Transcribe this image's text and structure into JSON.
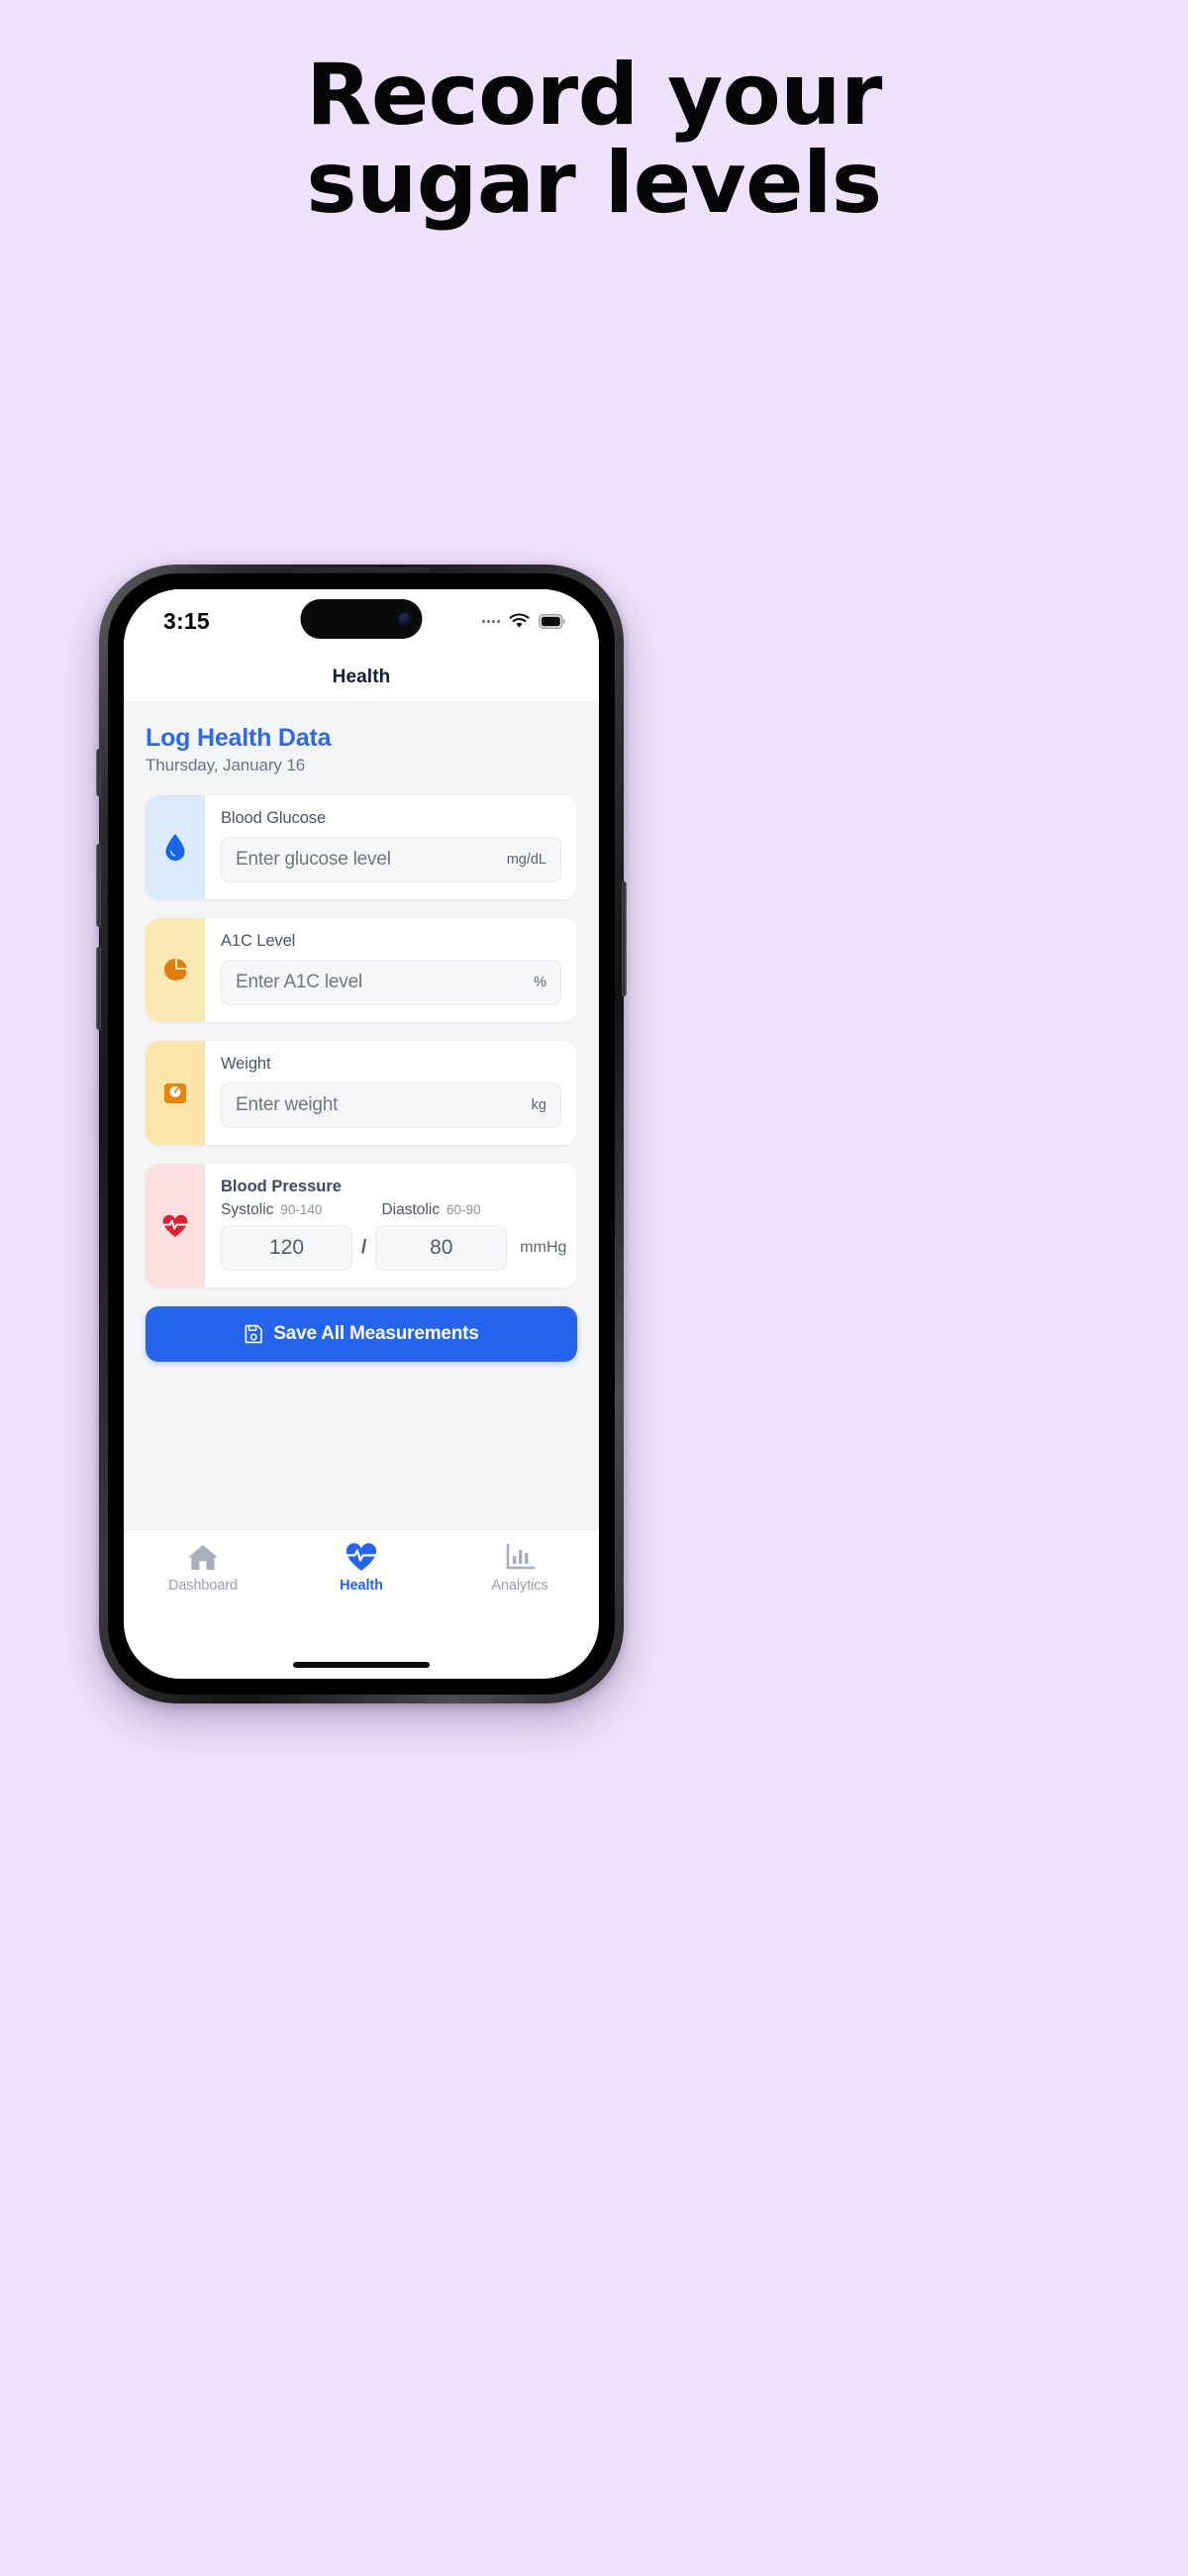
{
  "page": {
    "background_color": "#efe2fc",
    "headline_lines": [
      "Record your",
      "sugar levels"
    ]
  },
  "phone": {
    "status_bar": {
      "time": "3:15",
      "cellular_icon": "signal-dots-icon",
      "wifi_icon": "wifi-icon",
      "battery_icon": "battery-full-icon"
    },
    "nav_bar": {
      "title": "Health"
    }
  },
  "screen": {
    "section": {
      "title": "Log Health Data",
      "title_color": "#2f6ae4",
      "date": "Thursday, January 16"
    },
    "cards": [
      {
        "label": "Blood Glucose",
        "placeholder": "Enter glucose level",
        "unit": "mg/dL",
        "icon": "water-drop-icon",
        "icon_color": "#1a64e8",
        "strip_color": "#dcebfb"
      },
      {
        "label": "A1C Level",
        "placeholder": "Enter A1C level",
        "unit": "%",
        "icon": "pie-chart-icon",
        "icon_color": "#e07b10",
        "strip_color": "#fbe9b4"
      },
      {
        "label": "Weight",
        "placeholder": "Enter weight",
        "unit": "kg",
        "icon": "weight-scale-icon",
        "icon_color": "#e8830b",
        "strip_color": "#fbe5a8"
      }
    ],
    "blood_pressure": {
      "label": "Blood Pressure",
      "icon": "heart-pulse-icon",
      "icon_color": "#e0202f",
      "strip_color": "#fcdfdf",
      "systolic_name": "Systolic",
      "systolic_range": "90-140",
      "systolic_value": "120",
      "diastolic_name": "Diastolic",
      "diastolic_range": "60-90",
      "diastolic_value": "80",
      "separator": "/",
      "unit": "mmHg"
    },
    "save_button": {
      "label": "Save All Measurements",
      "icon": "save-floppy-icon",
      "color": "#2563eb"
    },
    "tabs": [
      {
        "label": "Dashboard",
        "icon": "home-icon",
        "active": false
      },
      {
        "label": "Health",
        "icon": "heart-pulse-icon",
        "active": true
      },
      {
        "label": "Analytics",
        "icon": "bar-chart-icon",
        "active": false
      }
    ]
  }
}
